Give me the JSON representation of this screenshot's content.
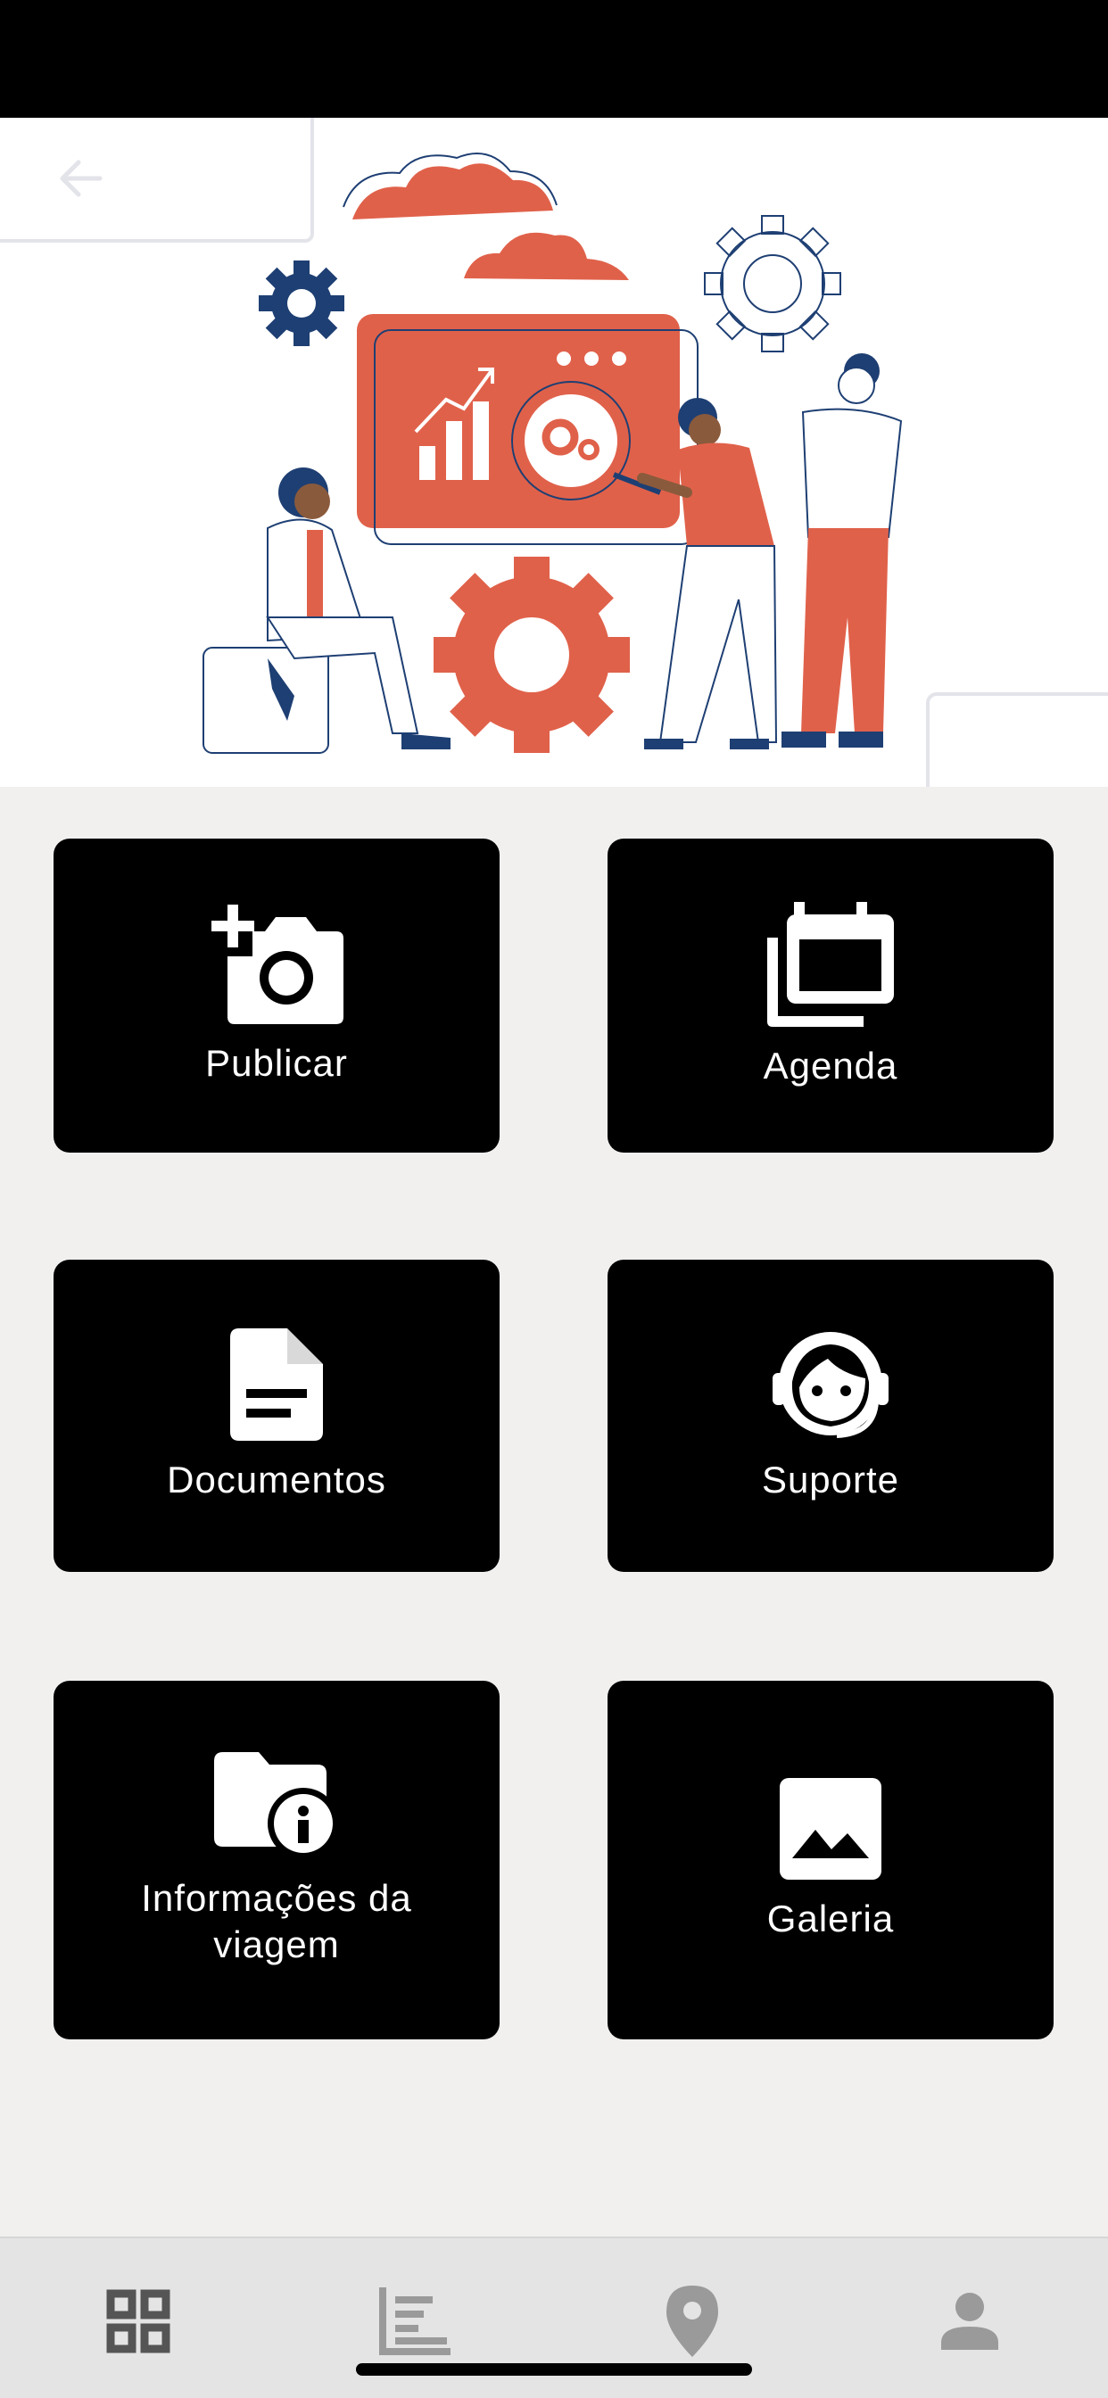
{
  "tiles": [
    {
      "label": "Publicar",
      "icon": "add-camera-icon"
    },
    {
      "label": "Agenda",
      "icon": "calendar-stack-icon"
    },
    {
      "label": "Documentos",
      "icon": "document-icon"
    },
    {
      "label": "Suporte",
      "icon": "support-agent-icon"
    },
    {
      "label": "Informações da viagem",
      "icon": "folder-info-icon"
    },
    {
      "label": "Galeria",
      "icon": "image-icon"
    }
  ],
  "bottom_nav": [
    {
      "icon": "grid-icon",
      "active": true
    },
    {
      "icon": "timeline-chart-icon",
      "active": false
    },
    {
      "icon": "location-pin-icon",
      "active": false
    },
    {
      "icon": "person-icon",
      "active": false
    }
  ],
  "colors": {
    "accent": "#e0614a",
    "navy": "#1e3f73",
    "tile_bg": "#000000",
    "page_bg": "#f1f0ef",
    "nav_bg": "#e4e4e4",
    "nav_icon": "#555555",
    "nav_icon_inactive": "#9a9a9a"
  }
}
